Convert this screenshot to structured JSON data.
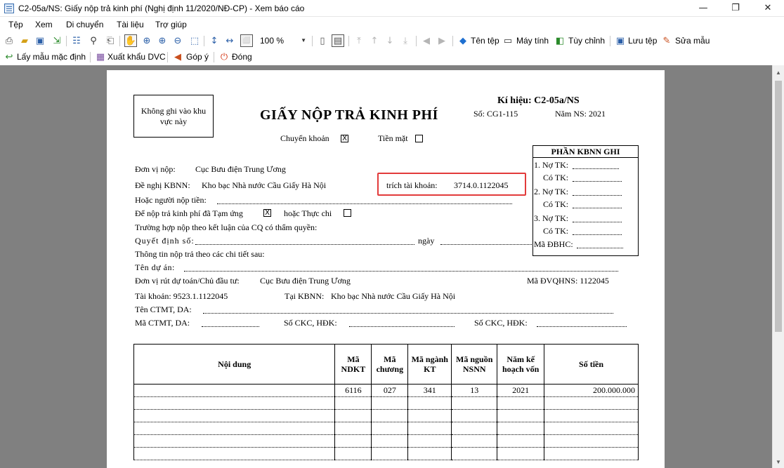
{
  "window": {
    "title": "C2-05a/NS: Giấy nộp trả kinh phí (Nghị định 11/2020/NĐ-CP) - Xem báo cáo",
    "min": "—",
    "max": "❐",
    "close": "✕"
  },
  "menu": [
    "Tệp",
    "Xem",
    "Di chuyển",
    "Tài liệu",
    "Trợ giúp"
  ],
  "toolbar": {
    "zoom_value": "100 %",
    "ten_tep": "Tên tệp",
    "may_tinh": "Máy tính",
    "tuy_chinh": "Tùy chỉnh",
    "luu_tep": "Lưu tệp",
    "sua_mau": "Sửa mẫu"
  },
  "toolbar2": {
    "lay_mau": "Lấy mẫu mặc định",
    "xuat_khau": "Xuất khẩu DVC",
    "gop_y": "Góp ý",
    "dong": "Đóng"
  },
  "doc": {
    "no_write": "Không ghi vào khu vực này",
    "title": "GIẤY NỘP TRẢ KINH PHÍ",
    "ki_hieu": "Kí hiệu: C2-05a/NS",
    "so": "Số: CG1-115",
    "nam_ns": "Năm NS: 2021",
    "chuyen_khoan": "Chuyển khoản",
    "chuyen_khoan_mark": "X",
    "tien_mat": "Tiền mặt",
    "don_vi_nop_label": "Đơn vị nộp:",
    "don_vi_nop": "Cục Bưu điện Trung Ương",
    "de_nghi_label": "Đề nghị KBNN:",
    "de_nghi": "Kho bạc Nhà nước Cầu Giấy Hà Nội",
    "trich_tk_label": "trích tài khoản:",
    "trich_tk": "3714.0.1122045",
    "hoac_nguoi_nop": "Hoặc người nộp tiền:",
    "de_nop_tam_ung": "Để nộp trả kinh phí đã Tạm ứng",
    "tam_ung_mark": "X",
    "hoac_thuc_chi": "hoặc Thực chi",
    "truong_hop": "Trường hợp nộp theo kết luận của CQ có thẩm quyền:",
    "quyet_dinh": "Quyết định số:",
    "ngay": "ngày",
    "thong_tin": "Thông tin nộp trả theo các chi tiết sau:",
    "ten_du_an": "Tên dự án:",
    "don_vi_rut_label": "Đơn vị rút dự toán/Chủ đầu tư:",
    "don_vi_rut": "Cục Bưu điện Trung Ương",
    "ma_dvqhns": "Mã ĐVQHNS: 1122045",
    "tai_khoan": "Tài khoản: 9523.1.1122045",
    "tai_kbnn_label": "Tại KBNN:",
    "tai_kbnn": "Kho bạc Nhà nước Cầu Giấy Hà Nội",
    "ten_ctmt": "Tên CTMT, DA:",
    "ma_ctmt": "Mã CTMT, DA:",
    "so_ckc_1": "Số CKC, HĐK:",
    "so_ckc_2": "Số CKC, HĐK:",
    "kbnn_box": {
      "header": "PHẦN KBNN GHI",
      "no1": "1. Nợ TK:",
      "co1": "Có TK:",
      "no2": "2. Nợ TK:",
      "co2": "Có TK:",
      "no3": "3. Nợ TK:",
      "co3": "Có TK:",
      "ma_dbhc": "Mã ĐBHC:"
    },
    "table": {
      "headers": [
        "Nội dung",
        "Mã NDKT",
        "Mã chương",
        "Mã ngành KT",
        "Mã nguồn NSNN",
        "Năm kế hoạch vốn",
        "Số tiền"
      ],
      "rows": [
        [
          "",
          "6116",
          "027",
          "341",
          "13",
          "2021",
          "200.000.000"
        ],
        [
          "",
          "",
          "",
          "",
          "",
          "",
          ""
        ],
        [
          "",
          "",
          "",
          "",
          "",
          "",
          ""
        ],
        [
          "",
          "",
          "",
          "",
          "",
          "",
          ""
        ],
        [
          "",
          "",
          "",
          "",
          "",
          "",
          ""
        ],
        [
          "",
          "",
          "",
          "",
          "",
          "",
          ""
        ]
      ]
    }
  }
}
